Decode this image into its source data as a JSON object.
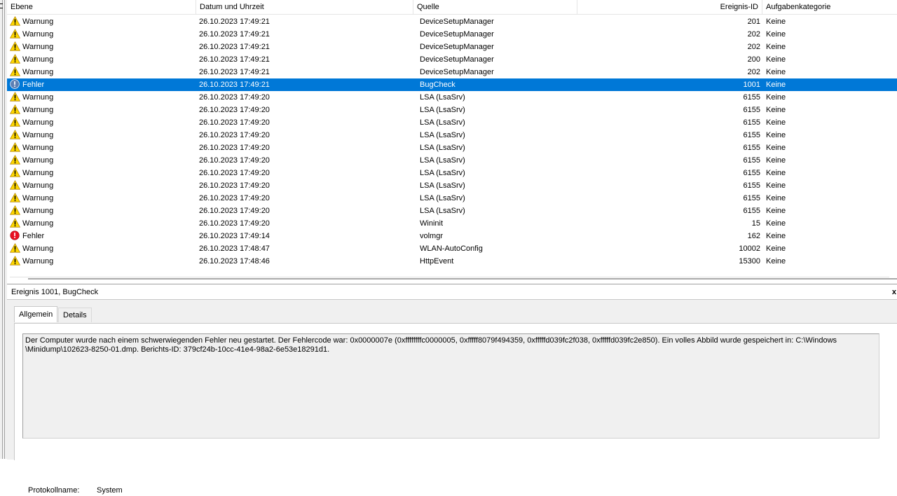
{
  "columns": {
    "level": "Ebene",
    "date": "Datum und Uhrzeit",
    "source": "Quelle",
    "event_id": "Ereignis-ID",
    "category": "Aufgabenkategorie"
  },
  "rows": [
    {
      "level": "Warnung",
      "type": "warning",
      "date": "26.10.2023 17:49:21",
      "source": "DeviceSetupManager",
      "event_id": "201",
      "category": "Keine",
      "selected": false
    },
    {
      "level": "Warnung",
      "type": "warning",
      "date": "26.10.2023 17:49:21",
      "source": "DeviceSetupManager",
      "event_id": "202",
      "category": "Keine",
      "selected": false
    },
    {
      "level": "Warnung",
      "type": "warning",
      "date": "26.10.2023 17:49:21",
      "source": "DeviceSetupManager",
      "event_id": "202",
      "category": "Keine",
      "selected": false
    },
    {
      "level": "Warnung",
      "type": "warning",
      "date": "26.10.2023 17:49:21",
      "source": "DeviceSetupManager",
      "event_id": "200",
      "category": "Keine",
      "selected": false
    },
    {
      "level": "Warnung",
      "type": "warning",
      "date": "26.10.2023 17:49:21",
      "source": "DeviceSetupManager",
      "event_id": "202",
      "category": "Keine",
      "selected": false
    },
    {
      "level": "Fehler",
      "type": "error-selected",
      "date": "26.10.2023 17:49:21",
      "source": "BugCheck",
      "event_id": "1001",
      "category": "Keine",
      "selected": true
    },
    {
      "level": "Warnung",
      "type": "warning",
      "date": "26.10.2023 17:49:20",
      "source": "LSA (LsaSrv)",
      "event_id": "6155",
      "category": "Keine",
      "selected": false
    },
    {
      "level": "Warnung",
      "type": "warning",
      "date": "26.10.2023 17:49:20",
      "source": "LSA (LsaSrv)",
      "event_id": "6155",
      "category": "Keine",
      "selected": false
    },
    {
      "level": "Warnung",
      "type": "warning",
      "date": "26.10.2023 17:49:20",
      "source": "LSA (LsaSrv)",
      "event_id": "6155",
      "category": "Keine",
      "selected": false
    },
    {
      "level": "Warnung",
      "type": "warning",
      "date": "26.10.2023 17:49:20",
      "source": "LSA (LsaSrv)",
      "event_id": "6155",
      "category": "Keine",
      "selected": false
    },
    {
      "level": "Warnung",
      "type": "warning",
      "date": "26.10.2023 17:49:20",
      "source": "LSA (LsaSrv)",
      "event_id": "6155",
      "category": "Keine",
      "selected": false
    },
    {
      "level": "Warnung",
      "type": "warning",
      "date": "26.10.2023 17:49:20",
      "source": "LSA (LsaSrv)",
      "event_id": "6155",
      "category": "Keine",
      "selected": false
    },
    {
      "level": "Warnung",
      "type": "warning",
      "date": "26.10.2023 17:49:20",
      "source": "LSA (LsaSrv)",
      "event_id": "6155",
      "category": "Keine",
      "selected": false
    },
    {
      "level": "Warnung",
      "type": "warning",
      "date": "26.10.2023 17:49:20",
      "source": "LSA (LsaSrv)",
      "event_id": "6155",
      "category": "Keine",
      "selected": false
    },
    {
      "level": "Warnung",
      "type": "warning",
      "date": "26.10.2023 17:49:20",
      "source": "LSA (LsaSrv)",
      "event_id": "6155",
      "category": "Keine",
      "selected": false
    },
    {
      "level": "Warnung",
      "type": "warning",
      "date": "26.10.2023 17:49:20",
      "source": "LSA (LsaSrv)",
      "event_id": "6155",
      "category": "Keine",
      "selected": false
    },
    {
      "level": "Warnung",
      "type": "warning",
      "date": "26.10.2023 17:49:20",
      "source": "Wininit",
      "event_id": "15",
      "category": "Keine",
      "selected": false
    },
    {
      "level": "Fehler",
      "type": "error",
      "date": "26.10.2023 17:49:14",
      "source": "volmgr",
      "event_id": "162",
      "category": "Keine",
      "selected": false
    },
    {
      "level": "Warnung",
      "type": "warning",
      "date": "26.10.2023 17:48:47",
      "source": "WLAN-AutoConfig",
      "event_id": "10002",
      "category": "Keine",
      "selected": false
    },
    {
      "level": "Warnung",
      "type": "warning",
      "date": "26.10.2023 17:48:46",
      "source": "HttpEvent",
      "event_id": "15300",
      "category": "Keine",
      "selected": false
    }
  ],
  "detail": {
    "title": "Ereignis 1001, BugCheck",
    "close_glyph": "x",
    "tabs": [
      {
        "label": "Allgemein",
        "active": true
      },
      {
        "label": "Details",
        "active": false
      }
    ],
    "message": "Der Computer wurde nach einem schwerwiegenden Fehler neu gestartet. Der Fehlercode war: 0x0000007e (0xffffffffc0000005, 0xfffff8079f494359, 0xfffffd039fc2f038, 0xfffffd039fc2e850). Ein volles Abbild wurde gespeichert in: C:\\Windows\n\\Minidump\\102623-8250-01.dmp. Berichts-ID: 379cf24b-10cc-41e4-98a2-6e53e18291d1.",
    "log_label": "Protokollname:",
    "log_value": "System"
  },
  "icons": {
    "warning": "warning-icon",
    "error": "error-icon",
    "error_selected": "error-info-icon"
  },
  "colors": {
    "selection": "#0078d7",
    "warning_fill": "#ffd800",
    "error_fill": "#e81123",
    "panel_bg": "#f0f0f0"
  }
}
